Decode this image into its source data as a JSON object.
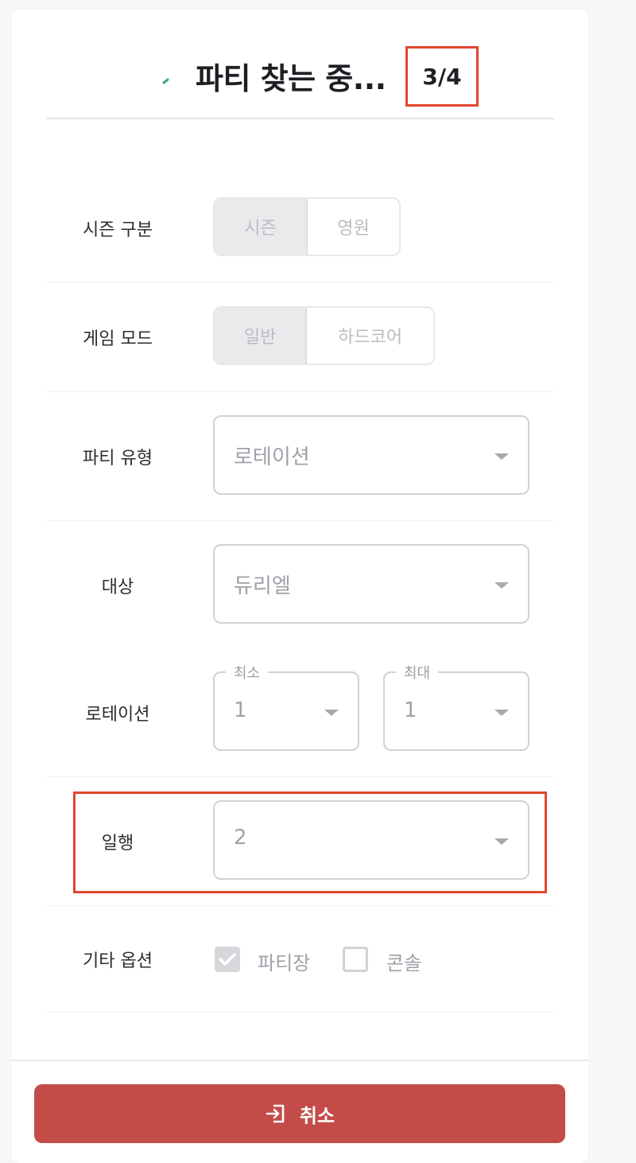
{
  "header": {
    "title": "파티 찾는 중...",
    "count": "3/4",
    "accent_color": "#34a86a"
  },
  "season": {
    "label": "시즌 구분",
    "options": [
      "시즌",
      "영원"
    ],
    "selected": "시즌"
  },
  "mode": {
    "label": "게임 모드",
    "options": [
      "일반",
      "하드코어"
    ],
    "selected": "일반"
  },
  "party_type": {
    "label": "파티 유형",
    "value": "로테이션"
  },
  "target": {
    "label": "대상",
    "value": "듀리엘"
  },
  "rotation": {
    "label": "로테이션",
    "min_legend": "최소",
    "min_value": "1",
    "max_legend": "최대",
    "max_value": "1"
  },
  "companions": {
    "label": "일행",
    "value": "2"
  },
  "other_options": {
    "label": "기타 옵션",
    "leader_label": "파티장",
    "leader_checked": true,
    "console_label": "콘솔",
    "console_checked": false
  },
  "footer": {
    "cancel_label": "취소",
    "cancel_color": "#c34c49"
  }
}
